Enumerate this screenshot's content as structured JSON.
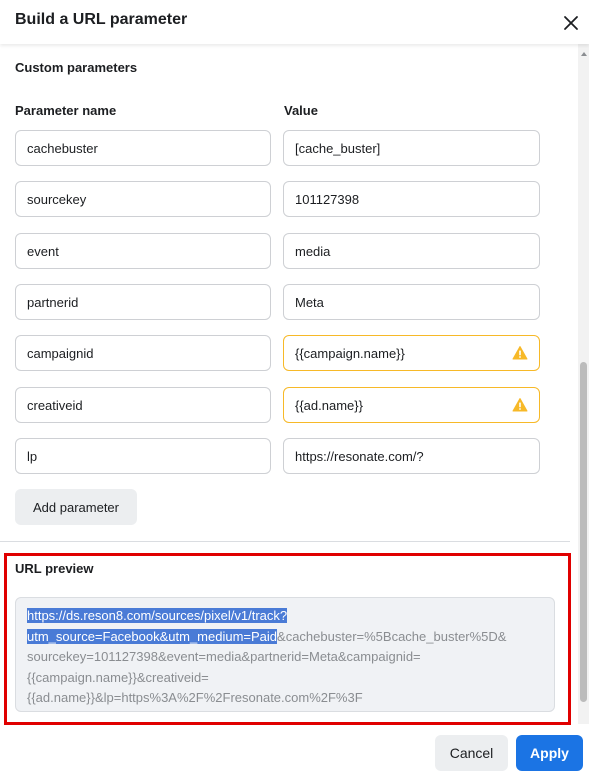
{
  "dialog": {
    "title": "Build a URL parameter",
    "close_icon": "close-icon"
  },
  "custom_parameters": {
    "section_title": "Custom parameters",
    "name_column_label": "Parameter name",
    "value_column_label": "Value",
    "rows": [
      {
        "name": "cachebuster",
        "value": "[cache_buster]",
        "warning": false
      },
      {
        "name": "sourcekey",
        "value": "101127398",
        "warning": false
      },
      {
        "name": "event",
        "value": "media",
        "warning": false
      },
      {
        "name": "partnerid",
        "value": "Meta",
        "warning": false
      },
      {
        "name": "campaignid",
        "value": "{{campaign.name}}",
        "warning": true
      },
      {
        "name": "creativeid",
        "value": "{{ad.name}}",
        "warning": true
      },
      {
        "name": "lp",
        "value": "https://resonate.com/?",
        "warning": false
      }
    ],
    "add_button_label": "Add parameter",
    "warning_icon": "warning-icon",
    "warning_color": "#f7b928"
  },
  "url_preview": {
    "label": "URL preview",
    "selected_text_line1": "https://ds.reson8.com/sources/pixel/v1/track?",
    "selected_text_line2": "utm_source=Facebook&utm_medium=Paid",
    "rest_line2": "&cachebuster=%5Bcache_buster%5D&",
    "line3": "sourcekey=101127398&event=media&partnerid=Meta&campaignid=",
    "line4": "{{campaign.name}}&creativeid=",
    "line5": "{{ad.name}}&lp=https%3A%2F%2Fresonate.com%2F%3F",
    "highlight_border_color": "#e00000"
  },
  "footer": {
    "cancel_label": "Cancel",
    "apply_label": "Apply",
    "apply_color": "#1b74e4"
  }
}
